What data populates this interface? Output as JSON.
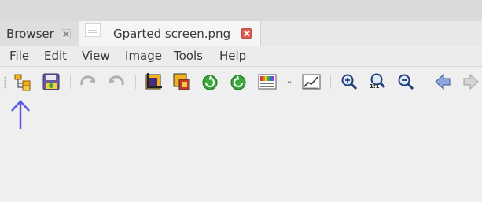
{
  "tabs": [
    {
      "label": "Browser"
    },
    {
      "label": "Gparted screen.png"
    }
  ],
  "menu": [
    "File",
    "Edit",
    "View",
    "Image",
    "Tools",
    "Help"
  ],
  "menu_mnemonics": [
    "F",
    "E",
    "V",
    "I",
    "T",
    "H"
  ],
  "toolbar_icons": [
    "folder-tree-icon",
    "save-icon",
    "undo-icon",
    "redo-icon",
    "crop-icon",
    "resize-icon",
    "rotate-left-icon",
    "rotate-right-icon",
    "adjust-colors-icon",
    "dropdown-arrow-icon",
    "histogram-icon",
    "zoom-in-icon",
    "zoom-1to1-icon",
    "zoom-out-icon",
    "previous-icon",
    "next-icon"
  ],
  "zoom_one_to_one_label": "1:1",
  "colors": {
    "accent_arrow": "#5a5ae6",
    "close_active": "#e25a4f",
    "folder": "#f3b21a",
    "green": "#3aa83a",
    "nav_blue": "#8ea8dc"
  }
}
